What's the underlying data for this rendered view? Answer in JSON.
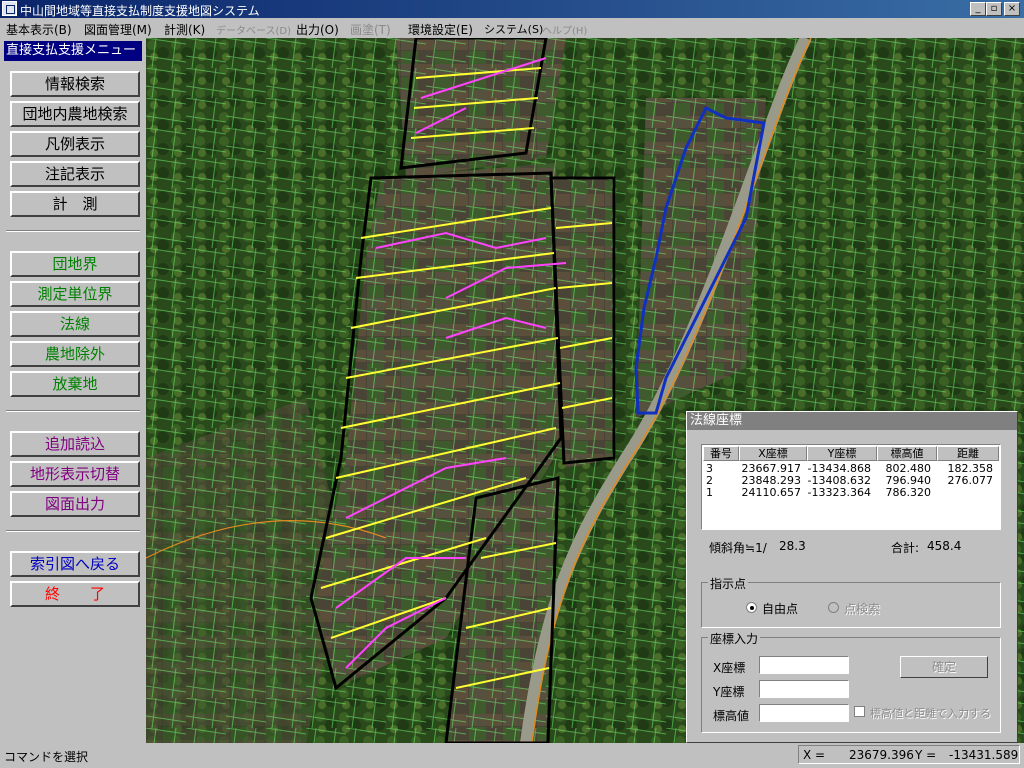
{
  "window": {
    "title": "中山間地域等直接支払制度支援地図システム"
  },
  "menu": [
    {
      "label": "基本表示(B)",
      "disabled": false
    },
    {
      "label": "図面管理(M)",
      "disabled": false
    },
    {
      "label": "計測(K)",
      "disabled": false
    },
    {
      "label": "データベース(D)",
      "disabled": true
    },
    {
      "label": "出力(O)",
      "disabled": false
    },
    {
      "label": "画塗(T)",
      "disabled": true
    },
    {
      "label": "環境設定(E)",
      "disabled": false
    },
    {
      "label": "システム(S)",
      "disabled": false
    },
    {
      "label": "ヘルプ(H)",
      "disabled": true
    }
  ],
  "sidebar": {
    "header": "直接支払支援メニュー",
    "buttons": [
      {
        "label": "情報検索",
        "color": "#000000"
      },
      {
        "label": "団地内農地検索",
        "color": "#000000"
      },
      {
        "label": "凡例表示",
        "color": "#000000"
      },
      {
        "label": "注記表示",
        "color": "#000000"
      },
      {
        "label": "計　測",
        "color": "#000000"
      },
      {
        "label": "団地界",
        "color": "#008000"
      },
      {
        "label": "測定単位界",
        "color": "#008000"
      },
      {
        "label": "法線",
        "color": "#008000"
      },
      {
        "label": "農地除外",
        "color": "#008000"
      },
      {
        "label": "放棄地",
        "color": "#008000"
      },
      {
        "label": "追加読込",
        "color": "#800080"
      },
      {
        "label": "地形表示切替",
        "color": "#800080"
      },
      {
        "label": "図面出力",
        "color": "#800080"
      },
      {
        "label": "索引図へ戻る",
        "color": "#0000c0"
      },
      {
        "label": "終　　了",
        "color": "#ff0000"
      }
    ]
  },
  "dialog": {
    "title": "法線座標",
    "columns": [
      "番号",
      "X座標",
      "Y座標",
      "標高値",
      "距離"
    ],
    "rows": [
      [
        "3",
        "23667.917",
        "-13434.868",
        "802.480",
        "182.358"
      ],
      [
        "2",
        "23848.293",
        "-13408.632",
        "796.940",
        "276.077"
      ],
      [
        "1",
        "24110.657",
        "-13323.364",
        "786.320",
        ""
      ]
    ],
    "slope_label": "傾斜角≒1/",
    "slope_value": "28.3",
    "total_label": "合計:",
    "total_value": "458.4",
    "point_group": "指示点",
    "radio_free": "自由点",
    "radio_search": "点検索",
    "coord_group": "座標入力",
    "x_label": "X座標",
    "y_label": "Y座標",
    "z_label": "標高値",
    "ok_label": "確定",
    "checkbox_label": "標高値と距離で入力する"
  },
  "status": {
    "command": "コマンドを選択",
    "x_label": "X =",
    "x_value": "23679.396",
    "y_label": "Y =",
    "y_value": "-13431.589"
  },
  "colors": {
    "parcel_line": "#7cff7c",
    "normal_line_yellow": "#ffff33",
    "normal_line_magenta": "#ff44ff",
    "boundary_black": "#000000",
    "selection_blue": "#1030c0",
    "road_orange": "#e08a20"
  }
}
